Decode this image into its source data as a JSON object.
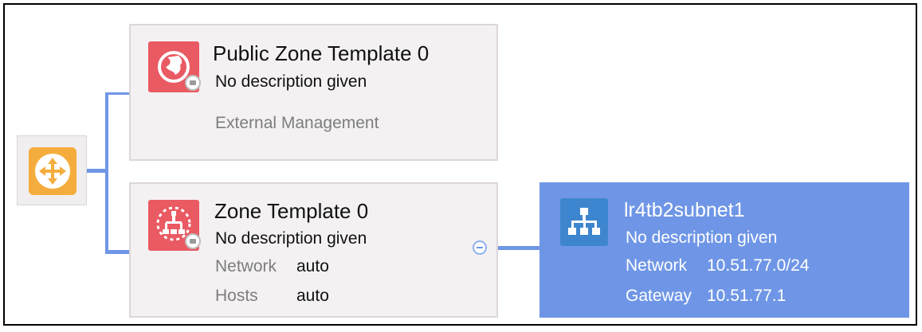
{
  "topology": {
    "router": {
      "icon": "router-icon",
      "color": "#f4ad3d"
    },
    "public_zone": {
      "icon": "globe-icon",
      "color": "#ea5a63",
      "title": "Public Zone Template 0",
      "description": "No description given",
      "type": "External Management"
    },
    "zone": {
      "icon": "network-zone-icon",
      "color": "#ea5a63",
      "title": "Zone Template 0",
      "description": "No description given",
      "network_label": "Network",
      "network_value": "auto",
      "hosts_label": "Hosts",
      "hosts_value": "auto"
    },
    "subnet": {
      "icon": "subnet-hierarchy-icon",
      "color": "#6f96e6",
      "title": "lr4tb2subnet1",
      "description": "No description given",
      "network_label": "Network",
      "network_value": "10.51.77.0/24",
      "gateway_label": "Gateway",
      "gateway_value": "10.51.77.1"
    }
  }
}
